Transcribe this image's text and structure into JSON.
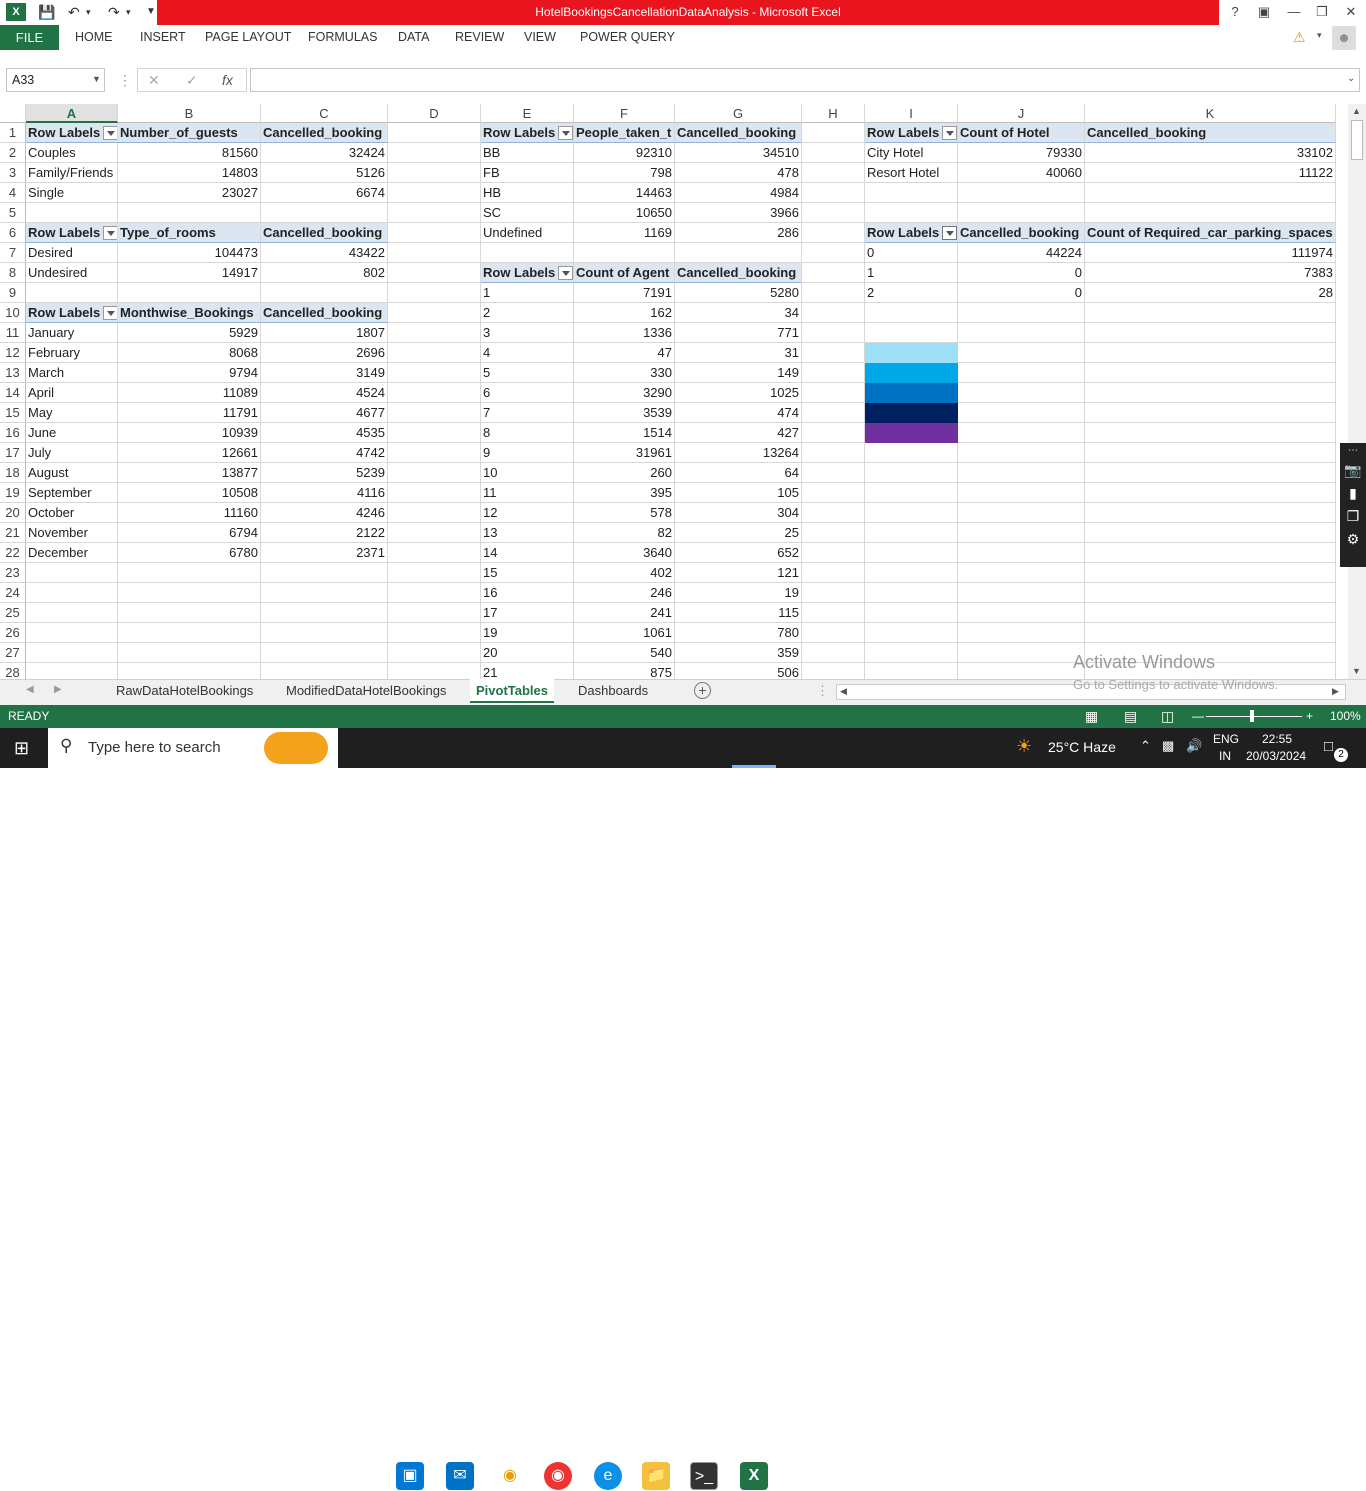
{
  "window": {
    "title": "HotelBookingsCancellationDataAnalysis -  Microsoft Excel",
    "help": "?"
  },
  "ribbon": {
    "file": "FILE",
    "tabs": [
      "HOME",
      "INSERT",
      "PAGE LAYOUT",
      "FORMULAS",
      "DATA",
      "REVIEW",
      "VIEW",
      "POWER QUERY"
    ]
  },
  "formula_bar": {
    "name_box": "A33",
    "formula": ""
  },
  "columns": [
    "A",
    "B",
    "C",
    "D",
    "E",
    "F",
    "G",
    "H",
    "I",
    "J",
    "K"
  ],
  "rows": [
    "1",
    "2",
    "3",
    "4",
    "5",
    "6",
    "7",
    "8",
    "9",
    "10",
    "11",
    "12",
    "13",
    "14",
    "15",
    "16",
    "17",
    "18",
    "19",
    "20",
    "21",
    "22",
    "23",
    "24",
    "25",
    "26",
    "27",
    "28"
  ],
  "pivot_guests": {
    "hdr": [
      "Row Labels",
      "Number_of_guests",
      "Cancelled_booking"
    ],
    "rows": [
      [
        "Couples",
        "81560",
        "32424"
      ],
      [
        "Family/Friends",
        "14803",
        "5126"
      ],
      [
        "Single",
        "23027",
        "6674"
      ]
    ]
  },
  "pivot_rooms": {
    "hdr": [
      "Row Labels",
      "Type_of_rooms",
      "Cancelled_booking"
    ],
    "rows": [
      [
        "Desired",
        "104473",
        "43422"
      ],
      [
        "Undesired",
        "14917",
        "802"
      ]
    ]
  },
  "pivot_months": {
    "hdr": [
      "Row Labels",
      "Monthwise_Bookings",
      "Cancelled_booking"
    ],
    "rows": [
      [
        "January",
        "5929",
        "1807"
      ],
      [
        "February",
        "8068",
        "2696"
      ],
      [
        "March",
        "9794",
        "3149"
      ],
      [
        "April",
        "11089",
        "4524"
      ],
      [
        "May",
        "11791",
        "4677"
      ],
      [
        "June",
        "10939",
        "4535"
      ],
      [
        "July",
        "12661",
        "4742"
      ],
      [
        "August",
        "13877",
        "5239"
      ],
      [
        "September",
        "10508",
        "4116"
      ],
      [
        "October",
        "11160",
        "4246"
      ],
      [
        "November",
        "6794",
        "2122"
      ],
      [
        "December",
        "6780",
        "2371"
      ]
    ]
  },
  "pivot_meal": {
    "hdr": [
      "Row Labels",
      "People_taken_t",
      "Cancelled_booking"
    ],
    "rows": [
      [
        "BB",
        "92310",
        "34510"
      ],
      [
        "FB",
        "798",
        "478"
      ],
      [
        "HB",
        "14463",
        "4984"
      ],
      [
        "SC",
        "10650",
        "3966"
      ],
      [
        "Undefined",
        "1169",
        "286"
      ]
    ]
  },
  "pivot_agent": {
    "hdr": [
      "Row Labels",
      "Count of Agent",
      "Cancelled_booking"
    ],
    "rows": [
      [
        "1",
        "7191",
        "5280"
      ],
      [
        "2",
        "162",
        "34"
      ],
      [
        "3",
        "1336",
        "771"
      ],
      [
        "4",
        "47",
        "31"
      ],
      [
        "5",
        "330",
        "149"
      ],
      [
        "6",
        "3290",
        "1025"
      ],
      [
        "7",
        "3539",
        "474"
      ],
      [
        "8",
        "1514",
        "427"
      ],
      [
        "9",
        "31961",
        "13264"
      ],
      [
        "10",
        "260",
        "64"
      ],
      [
        "11",
        "395",
        "105"
      ],
      [
        "12",
        "578",
        "304"
      ],
      [
        "13",
        "82",
        "25"
      ],
      [
        "14",
        "3640",
        "652"
      ],
      [
        "15",
        "402",
        "121"
      ],
      [
        "16",
        "246",
        "19"
      ],
      [
        "17",
        "241",
        "115"
      ],
      [
        "19",
        "1061",
        "780"
      ],
      [
        "20",
        "540",
        "359"
      ],
      [
        "21",
        "875",
        "506"
      ]
    ]
  },
  "pivot_hotel": {
    "hdr": [
      "Row Labels",
      "Count of Hotel",
      "Cancelled_booking"
    ],
    "rows": [
      [
        "City Hotel",
        "79330",
        "33102"
      ],
      [
        "Resort Hotel",
        "40060",
        "11122"
      ]
    ]
  },
  "pivot_parking": {
    "hdr": [
      "Row Labels",
      "Cancelled_booking",
      "Count of Required_car_parking_spaces"
    ],
    "rows": [
      [
        "0",
        "44224",
        "111974"
      ],
      [
        "1",
        "0",
        "7383"
      ],
      [
        "2",
        "0",
        "28"
      ]
    ]
  },
  "swatches": [
    "#9de0f5",
    "#00a8e8",
    "#0070c0",
    "#002060",
    "#7030a0"
  ],
  "sheets": [
    "RawDataHotelBookings",
    "ModifiedDataHotelBookings",
    "PivotTables",
    "Dashboards"
  ],
  "status": {
    "ready": "READY",
    "zoom": "100%"
  },
  "watermark": {
    "line1": "Activate Windows",
    "line2": "Go to Settings to activate Windows."
  },
  "taskbar": {
    "search": "Type here to search",
    "weather": "25°C  Haze",
    "lang1": "ENG",
    "lang2": "IN",
    "time": "22:55",
    "date": "20/03/2024",
    "notif": "2"
  }
}
